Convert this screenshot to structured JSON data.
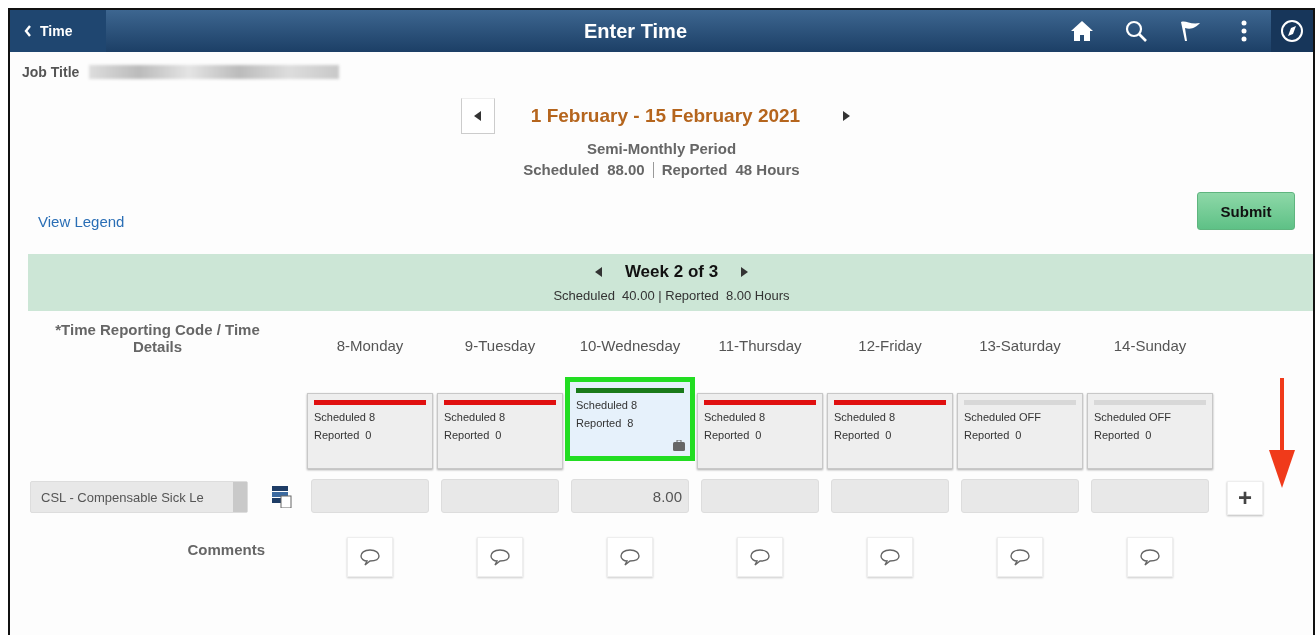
{
  "header": {
    "back_label": "Time",
    "title": "Enter Time"
  },
  "job_title": {
    "label": "Job Title",
    "redacted": true
  },
  "period": {
    "range": "1 February - 15 February 2021",
    "type": "Semi-Monthly Period",
    "scheduled_label": "Scheduled",
    "scheduled": "88.00",
    "reported_label": "Reported",
    "reported": "48 Hours"
  },
  "legend_link": "View Legend",
  "submit_button": "Submit",
  "week": {
    "title": "Week 2 of 3",
    "summary": "Scheduled  40.00 | Reported  8.00 Hours"
  },
  "code_column_heading": "*Time Reporting Code / Time Details",
  "days": [
    {
      "label": "8-Monday",
      "scheduled": "Scheduled 8",
      "reported": "Reported  0",
      "color": "#e01010",
      "highlighted": false,
      "attachment": false
    },
    {
      "label": "9-Tuesday",
      "scheduled": "Scheduled 8",
      "reported": "Reported  0",
      "color": "#e01010",
      "highlighted": false,
      "attachment": false
    },
    {
      "label": "10-Wednesday",
      "scheduled": "Scheduled 8",
      "reported": "Reported  8",
      "color": "#1a7a1a",
      "highlighted": true,
      "attachment": true,
      "hours": "8.00"
    },
    {
      "label": "11-Thursday",
      "scheduled": "Scheduled 8",
      "reported": "Reported  0",
      "color": "#e01010",
      "highlighted": false,
      "attachment": false
    },
    {
      "label": "12-Friday",
      "scheduled": "Scheduled 8",
      "reported": "Reported  0",
      "color": "#e01010",
      "highlighted": false,
      "attachment": false
    },
    {
      "label": "13-Saturday",
      "scheduled": "Scheduled OFF",
      "reported": "Reported  0",
      "color": "#d8d8d8",
      "highlighted": false,
      "attachment": false
    },
    {
      "label": "14-Sunday",
      "scheduled": "Scheduled OFF",
      "reported": "Reported  0",
      "color": "#d8d8d8",
      "highlighted": false,
      "attachment": false
    }
  ],
  "time_code": "CSL - Compensable Sick Le",
  "comments_label": "Comments",
  "add_row_button": "+",
  "annotation_arrow": true
}
